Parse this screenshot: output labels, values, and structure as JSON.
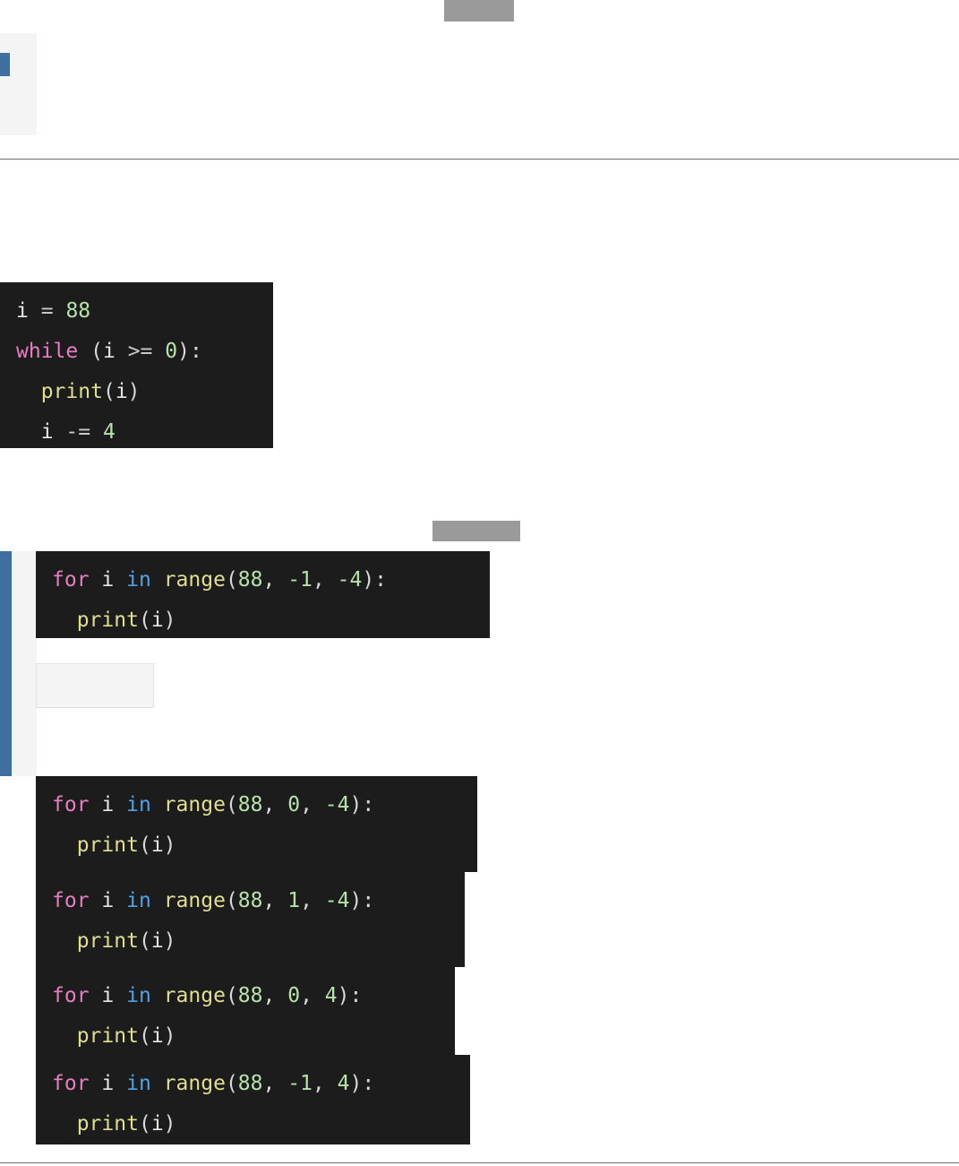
{
  "page": {
    "background_color": "#ffffff",
    "redaction_color": "#9a9a9a",
    "accent_color": "#3f6f9f",
    "panel_color": "#f4f4f4",
    "code_background": "#1c1c1c"
  },
  "top_region": {
    "redacted_bar_label": "",
    "selected_marker_label": "",
    "panel_label": ""
  },
  "question_code": {
    "label": "while-loop-snippet",
    "lines": [
      [
        {
          "text": "i",
          "kind": "var"
        },
        {
          "text": " ",
          "kind": "plain"
        },
        {
          "text": "=",
          "kind": "op"
        },
        {
          "text": " ",
          "kind": "plain"
        },
        {
          "text": "88",
          "kind": "num"
        }
      ],
      [
        {
          "text": "while",
          "kind": "kw"
        },
        {
          "text": " ",
          "kind": "plain"
        },
        {
          "text": "(",
          "kind": "punc"
        },
        {
          "text": "i",
          "kind": "var"
        },
        {
          "text": " ",
          "kind": "plain"
        },
        {
          "text": ">=",
          "kind": "op"
        },
        {
          "text": " ",
          "kind": "plain"
        },
        {
          "text": "0",
          "kind": "num"
        },
        {
          "text": ")",
          "kind": "punc"
        },
        {
          "text": ":",
          "kind": "punc"
        }
      ],
      [
        {
          "text": "  ",
          "kind": "plain"
        },
        {
          "text": "print",
          "kind": "fn"
        },
        {
          "text": "(",
          "kind": "punc"
        },
        {
          "text": "i",
          "kind": "var"
        },
        {
          "text": ")",
          "kind": "punc"
        }
      ],
      [
        {
          "text": "  ",
          "kind": "plain"
        },
        {
          "text": "i",
          "kind": "var"
        },
        {
          "text": " ",
          "kind": "plain"
        },
        {
          "text": "-=",
          "kind": "op"
        },
        {
          "text": " ",
          "kind": "plain"
        },
        {
          "text": "4",
          "kind": "num"
        }
      ]
    ]
  },
  "highlighted_answer": {
    "label": "for-range-88-minus1-minus4",
    "lines": [
      [
        {
          "text": "for",
          "kind": "kw"
        },
        {
          "text": " ",
          "kind": "plain"
        },
        {
          "text": "i",
          "kind": "var"
        },
        {
          "text": " ",
          "kind": "plain"
        },
        {
          "text": "in",
          "kind": "in"
        },
        {
          "text": " ",
          "kind": "plain"
        },
        {
          "text": "range",
          "kind": "fn"
        },
        {
          "text": "(",
          "kind": "punc"
        },
        {
          "text": "88",
          "kind": "num"
        },
        {
          "text": ", ",
          "kind": "punc"
        },
        {
          "text": "-1",
          "kind": "num"
        },
        {
          "text": ", ",
          "kind": "punc"
        },
        {
          "text": "-4",
          "kind": "num"
        },
        {
          "text": ")",
          "kind": "punc"
        },
        {
          "text": ":",
          "kind": "punc"
        }
      ],
      [
        {
          "text": "  ",
          "kind": "plain"
        },
        {
          "text": "print",
          "kind": "fn"
        },
        {
          "text": "(",
          "kind": "punc"
        },
        {
          "text": "i",
          "kind": "var"
        },
        {
          "text": ")",
          "kind": "punc"
        }
      ]
    ]
  },
  "empty_field": {
    "label": "blank-answer-box",
    "value": ""
  },
  "options": [
    {
      "label": "option-for-range-88-0-minus4",
      "lines": [
        [
          {
            "text": "for",
            "kind": "kw"
          },
          {
            "text": " ",
            "kind": "plain"
          },
          {
            "text": "i",
            "kind": "var"
          },
          {
            "text": " ",
            "kind": "plain"
          },
          {
            "text": "in",
            "kind": "in"
          },
          {
            "text": " ",
            "kind": "plain"
          },
          {
            "text": "range",
            "kind": "fn"
          },
          {
            "text": "(",
            "kind": "punc"
          },
          {
            "text": "88",
            "kind": "num"
          },
          {
            "text": ", ",
            "kind": "punc"
          },
          {
            "text": "0",
            "kind": "num"
          },
          {
            "text": ", ",
            "kind": "punc"
          },
          {
            "text": "-4",
            "kind": "num"
          },
          {
            "text": ")",
            "kind": "punc"
          },
          {
            "text": ":",
            "kind": "punc"
          }
        ],
        [
          {
            "text": "  ",
            "kind": "plain"
          },
          {
            "text": "print",
            "kind": "fn"
          },
          {
            "text": "(",
            "kind": "punc"
          },
          {
            "text": "i",
            "kind": "var"
          },
          {
            "text": ")",
            "kind": "punc"
          }
        ]
      ]
    },
    {
      "label": "option-for-range-88-1-minus4",
      "lines": [
        [
          {
            "text": "for",
            "kind": "kw"
          },
          {
            "text": " ",
            "kind": "plain"
          },
          {
            "text": "i",
            "kind": "var"
          },
          {
            "text": " ",
            "kind": "plain"
          },
          {
            "text": "in",
            "kind": "in"
          },
          {
            "text": " ",
            "kind": "plain"
          },
          {
            "text": "range",
            "kind": "fn"
          },
          {
            "text": "(",
            "kind": "punc"
          },
          {
            "text": "88",
            "kind": "num"
          },
          {
            "text": ", ",
            "kind": "punc"
          },
          {
            "text": "1",
            "kind": "num"
          },
          {
            "text": ", ",
            "kind": "punc"
          },
          {
            "text": "-4",
            "kind": "num"
          },
          {
            "text": ")",
            "kind": "punc"
          },
          {
            "text": ":",
            "kind": "punc"
          }
        ],
        [
          {
            "text": "  ",
            "kind": "plain"
          },
          {
            "text": "print",
            "kind": "fn"
          },
          {
            "text": "(",
            "kind": "punc"
          },
          {
            "text": "i",
            "kind": "var"
          },
          {
            "text": ")",
            "kind": "punc"
          }
        ]
      ]
    },
    {
      "label": "option-for-range-88-0-4",
      "lines": [
        [
          {
            "text": "for",
            "kind": "kw"
          },
          {
            "text": " ",
            "kind": "plain"
          },
          {
            "text": "i",
            "kind": "var"
          },
          {
            "text": " ",
            "kind": "plain"
          },
          {
            "text": "in",
            "kind": "in"
          },
          {
            "text": " ",
            "kind": "plain"
          },
          {
            "text": "range",
            "kind": "fn"
          },
          {
            "text": "(",
            "kind": "punc"
          },
          {
            "text": "88",
            "kind": "num"
          },
          {
            "text": ", ",
            "kind": "punc"
          },
          {
            "text": "0",
            "kind": "num"
          },
          {
            "text": ", ",
            "kind": "punc"
          },
          {
            "text": "4",
            "kind": "num"
          },
          {
            "text": ")",
            "kind": "punc"
          },
          {
            "text": ":",
            "kind": "punc"
          }
        ],
        [
          {
            "text": "  ",
            "kind": "plain"
          },
          {
            "text": "print",
            "kind": "fn"
          },
          {
            "text": "(",
            "kind": "punc"
          },
          {
            "text": "i",
            "kind": "var"
          },
          {
            "text": ")",
            "kind": "punc"
          }
        ]
      ]
    },
    {
      "label": "option-for-range-88-minus1-4",
      "lines": [
        [
          {
            "text": "for",
            "kind": "kw"
          },
          {
            "text": " ",
            "kind": "plain"
          },
          {
            "text": "i",
            "kind": "var"
          },
          {
            "text": " ",
            "kind": "plain"
          },
          {
            "text": "in",
            "kind": "in"
          },
          {
            "text": " ",
            "kind": "plain"
          },
          {
            "text": "range",
            "kind": "fn"
          },
          {
            "text": "(",
            "kind": "punc"
          },
          {
            "text": "88",
            "kind": "num"
          },
          {
            "text": ", ",
            "kind": "punc"
          },
          {
            "text": "-1",
            "kind": "num"
          },
          {
            "text": ", ",
            "kind": "punc"
          },
          {
            "text": "4",
            "kind": "num"
          },
          {
            "text": ")",
            "kind": "punc"
          },
          {
            "text": ":",
            "kind": "punc"
          }
        ],
        [
          {
            "text": "  ",
            "kind": "plain"
          },
          {
            "text": "print",
            "kind": "fn"
          },
          {
            "text": "(",
            "kind": "punc"
          },
          {
            "text": "i",
            "kind": "var"
          },
          {
            "text": ")",
            "kind": "punc"
          }
        ]
      ]
    }
  ]
}
